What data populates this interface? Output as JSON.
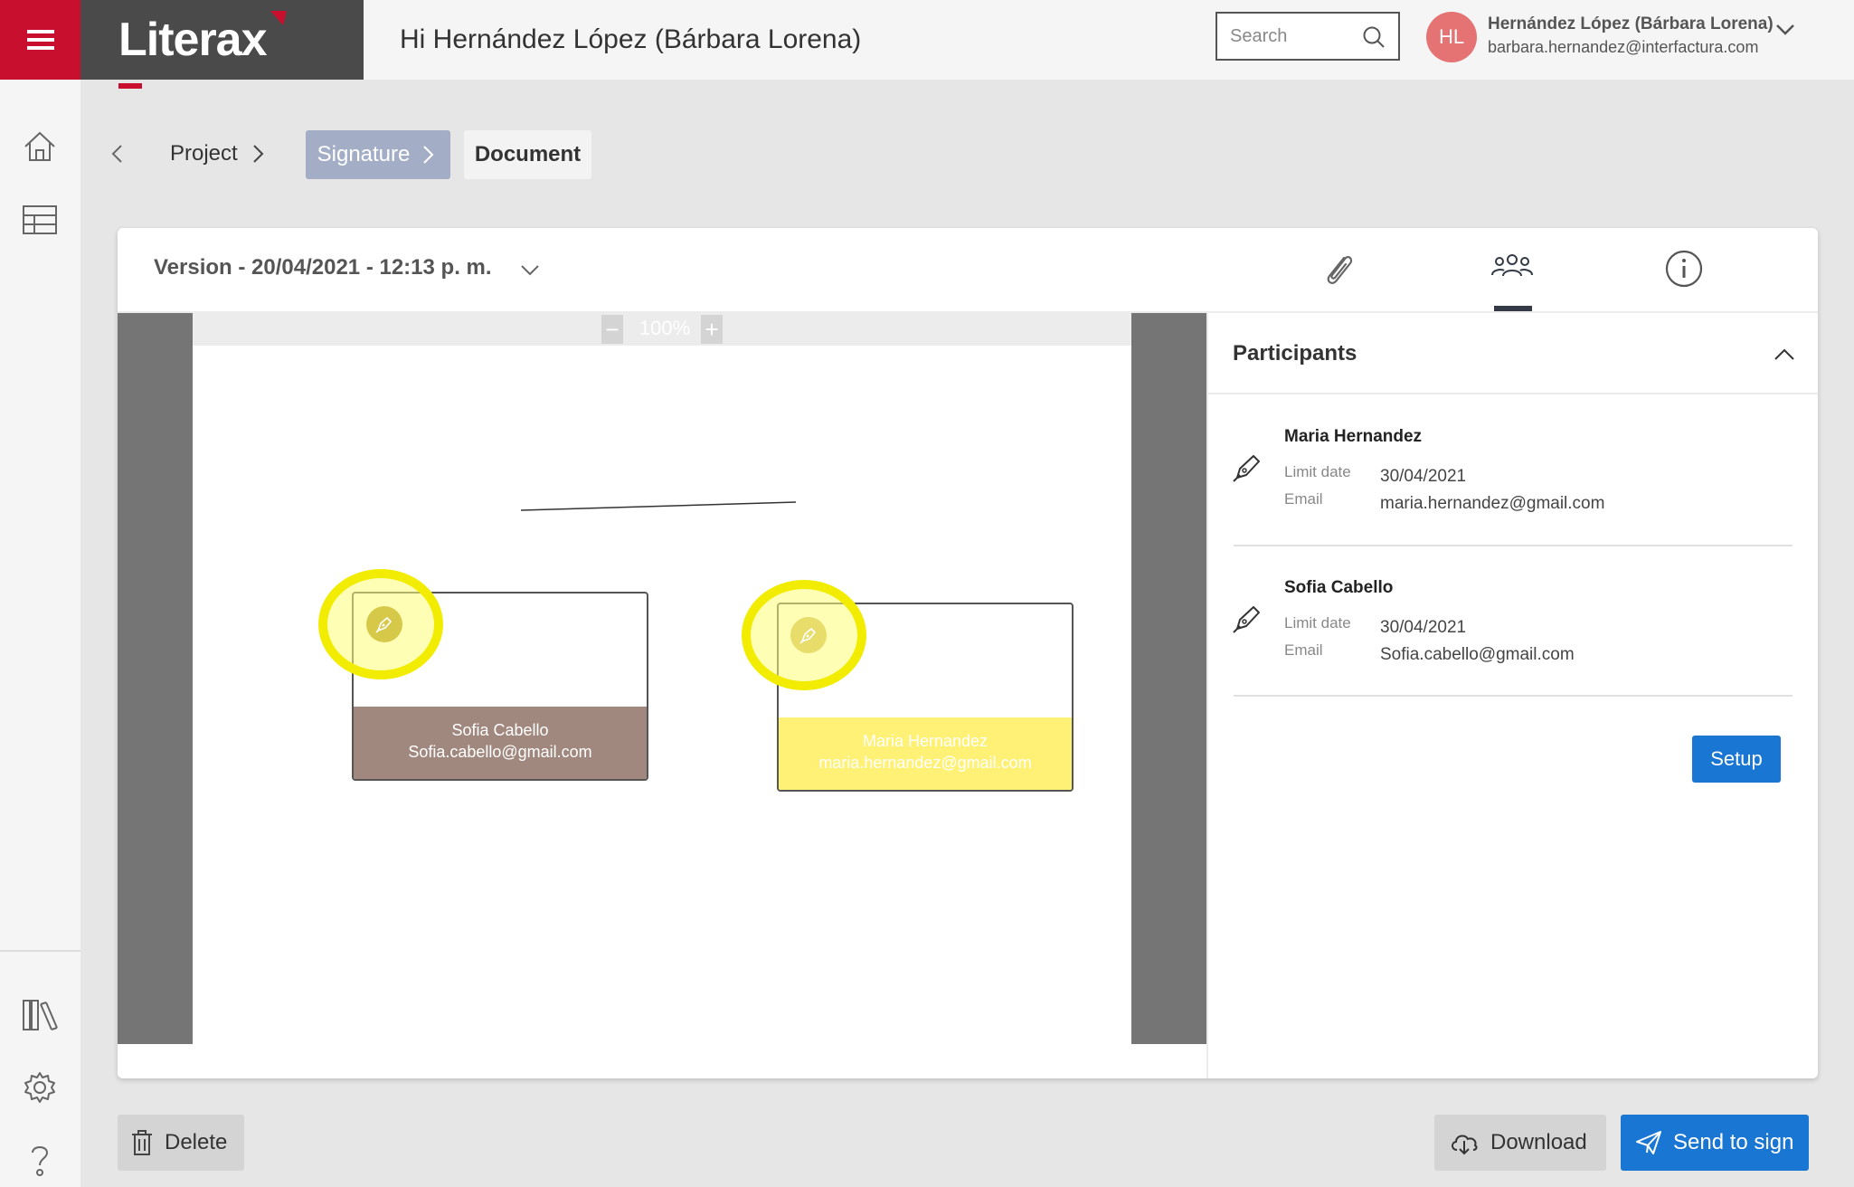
{
  "app": {
    "logo": "Literax",
    "accent": "#c8102e"
  },
  "header": {
    "greeting": "Hi Hernández López (Bárbara Lorena)",
    "search_placeholder": "Search",
    "user": {
      "initials": "HL",
      "name": "Hernández López (Bárbara Lorena)",
      "email": "barbara.hernandez@interfactura.com"
    }
  },
  "nav": {
    "top_icons": [
      "home-icon",
      "table-icon"
    ],
    "bottom_icons": [
      "library-icon",
      "gear-icon",
      "help-icon"
    ]
  },
  "breadcrumb": {
    "items": [
      {
        "label": "Project"
      },
      {
        "label": "Signature"
      },
      {
        "label": "Document"
      }
    ]
  },
  "document": {
    "version": "Version - 20/04/2021 - 12:13 p. m.",
    "tabs": [
      "attachment-icon",
      "participants-icon",
      "info-icon"
    ],
    "active_tab": "participants",
    "zoom": {
      "level": "100%",
      "minus": "−",
      "plus": "+"
    },
    "signature_boxes": [
      {
        "name": "Sofia Cabello",
        "email": "Sofia.cabello@gmail.com",
        "color": "#a1887f"
      },
      {
        "name": "Maria Hernandez",
        "email": "maria.hernandez@gmail.com",
        "color": "#fff176"
      }
    ]
  },
  "participants": {
    "title": "Participants",
    "limit_label": "Limit date",
    "email_label": "Email",
    "list": [
      {
        "name": "Maria Hernandez",
        "limit_date": "30/04/2021",
        "email": "maria.hernandez@gmail.com"
      },
      {
        "name": "Sofia Cabello",
        "limit_date": "30/04/2021",
        "email": "Sofia.cabello@gmail.com"
      }
    ],
    "setup_label": "Setup"
  },
  "actions": {
    "delete_label": "Delete",
    "download_label": "Download",
    "send_label": "Send to sign"
  }
}
